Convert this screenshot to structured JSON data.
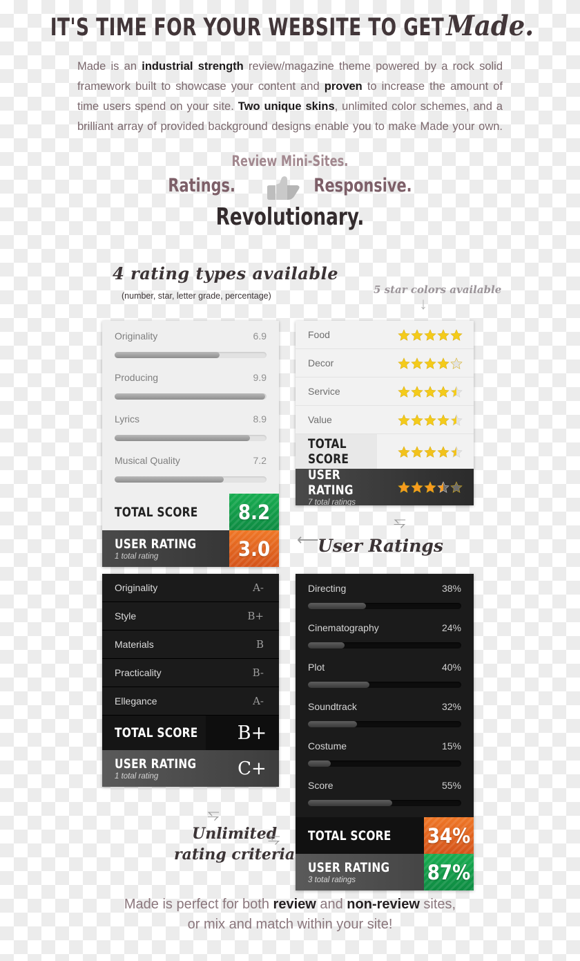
{
  "headline": {
    "main": "IT'S TIME FOR YOUR WEBSITE TO GET",
    "script": "Made."
  },
  "intro": {
    "p1": "Made is an ",
    "b1": "industrial strength",
    "p2": " review/magazine theme powered by a rock solid framework built to showcase your content and ",
    "b2": "proven",
    "p3": " to increase the amount of time users spend on your site. ",
    "b3": "Two unique skins",
    "p4": ", unlimited color schemes, and a brilliant array of provided background designs enable you to make Made your own."
  },
  "tagline": {
    "line1": "Review Mini-Sites.",
    "line2a": "Ratings.",
    "line2b": "Responsive.",
    "line3": "Revolutionary."
  },
  "annotations": {
    "rating_types": "4 rating types available",
    "rating_types_sub": "(number, star, letter grade, percentage)",
    "star_colors": "5 star colors available",
    "user_ratings": "User Ratings",
    "unlimited_1": "Unlimited",
    "unlimited_2": "rating criteria"
  },
  "panel_number": {
    "criteria": [
      {
        "name": "Originality",
        "value": "6.9",
        "pct": 69
      },
      {
        "name": "Producing",
        "value": "9.9",
        "pct": 99
      },
      {
        "name": "Lyrics",
        "value": "8.9",
        "pct": 89
      },
      {
        "name": "Musical Quality",
        "value": "7.2",
        "pct": 72
      }
    ],
    "total": {
      "label": "TOTAL SCORE",
      "value": "8.2",
      "color": "#13a04b"
    },
    "user": {
      "label": "USER RATING",
      "sub": "1 total rating",
      "value": "3.0",
      "color": "#e2671f"
    }
  },
  "panel_star": {
    "criteria": [
      {
        "name": "Food",
        "stars": 5
      },
      {
        "name": "Decor",
        "stars": 4
      },
      {
        "name": "Service",
        "stars": 4.5
      },
      {
        "name": "Value",
        "stars": 4.5
      }
    ],
    "total": {
      "label": "TOTAL SCORE",
      "stars": 4.5,
      "color": "#f2c21c"
    },
    "user": {
      "label": "USER RATING",
      "sub": "7 total ratings",
      "stars": 3.5,
      "color": "#f79a1e"
    }
  },
  "panel_grade": {
    "criteria": [
      {
        "name": "Originality",
        "value": "A-"
      },
      {
        "name": "Style",
        "value": "B+"
      },
      {
        "name": "Materials",
        "value": "B"
      },
      {
        "name": "Practicality",
        "value": "B-"
      },
      {
        "name": "Ellegance",
        "value": "A-"
      }
    ],
    "total": {
      "label": "TOTAL SCORE",
      "value": "B+"
    },
    "user": {
      "label": "USER RATING",
      "sub": "1 total rating",
      "value": "C+"
    }
  },
  "panel_percent": {
    "criteria": [
      {
        "name": "Directing",
        "value": "38%",
        "pct": 38
      },
      {
        "name": "Cinematography",
        "value": "24%",
        "pct": 24
      },
      {
        "name": "Plot",
        "value": "40%",
        "pct": 40
      },
      {
        "name": "Soundtrack",
        "value": "32%",
        "pct": 32
      },
      {
        "name": "Costume",
        "value": "15%",
        "pct": 15
      },
      {
        "name": "Score",
        "value": "55%",
        "pct": 55
      }
    ],
    "total": {
      "label": "TOTAL SCORE",
      "value": "34%",
      "color": "#e2671f"
    },
    "user": {
      "label": "USER RATING",
      "sub": "3 total ratings",
      "value": "87%",
      "color": "#13a04b"
    }
  },
  "footer": {
    "p1": "Made is perfect for both ",
    "b1": "review",
    "p2": " and ",
    "b2": "non-review",
    "p3": " sites,",
    "line2": "or mix and match within your site!"
  }
}
